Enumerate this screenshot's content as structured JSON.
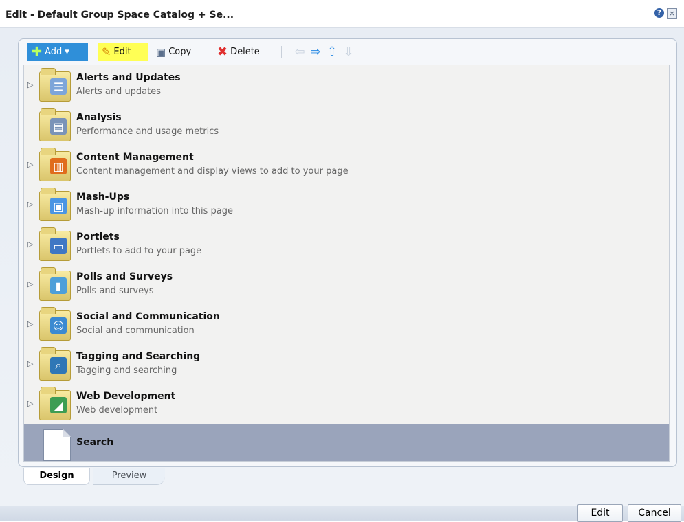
{
  "title": "Edit - Default Group Space Catalog + Se...",
  "toolbar": {
    "add": "Add",
    "edit": "Edit",
    "copy": "Copy",
    "delete": "Delete"
  },
  "rows": [
    {
      "title": "Alerts and Updates",
      "desc": "Alerts and updates",
      "icon": "alerts-folder-icon",
      "overlay": "message-icon",
      "overlayColor": "#7da5d9"
    },
    {
      "title": "Analysis",
      "desc": "Performance and usage metrics",
      "icon": "analysis-folder-icon",
      "overlay": "chart-document-icon",
      "overlayColor": "#7a93b8"
    },
    {
      "title": "Content Management",
      "desc": "Content management and display views to add to your page",
      "icon": "content-management-folder-icon",
      "overlay": "books-icon",
      "overlayColor": "#e06d1d"
    },
    {
      "title": "Mash-Ups",
      "desc": "Mash-up information into this page",
      "icon": "mashups-folder-icon",
      "overlay": "windows-icon",
      "overlayColor": "#4a95e3"
    },
    {
      "title": "Portlets",
      "desc": "Portlets to add to your page",
      "icon": "portlets-folder-icon",
      "overlay": "portlet-icon",
      "overlayColor": "#3f77c4"
    },
    {
      "title": "Polls and Surveys",
      "desc": "Polls and surveys",
      "icon": "polls-folder-icon",
      "overlay": "bar-chart-icon",
      "overlayColor": "#4e9fd9"
    },
    {
      "title": "Social and Communication",
      "desc": "Social and communication",
      "icon": "social-folder-icon",
      "overlay": "people-icon",
      "overlayColor": "#3b8ad1"
    },
    {
      "title": "Tagging and Searching",
      "desc": "Tagging and searching",
      "icon": "tagging-folder-icon",
      "overlay": "search-icon",
      "overlayColor": "#2f77b6"
    },
    {
      "title": "Web Development",
      "desc": "Web development",
      "icon": "web-development-folder-icon",
      "overlay": "triangle-icon",
      "overlayColor": "#3d9d53"
    },
    {
      "title": "Search",
      "desc": "",
      "icon": "document-icon"
    }
  ],
  "tabs": {
    "design": "Design",
    "preview": "Preview"
  },
  "footer": {
    "edit": "Edit",
    "cancel": "Cancel"
  }
}
